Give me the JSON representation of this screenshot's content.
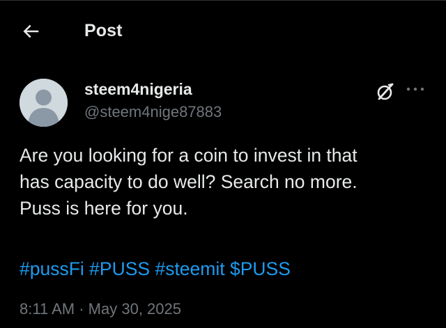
{
  "header": {
    "back_icon": "arrow-left-icon",
    "title": "Post"
  },
  "author": {
    "display_name": "steem4nigeria",
    "handle": "@steem4nige87883",
    "avatar": "default-avatar-silhouette"
  },
  "actions": {
    "grok_icon": "grok-icon",
    "more_icon": "more-horizontal-icon"
  },
  "post": {
    "lines": [
      "Are you looking for a coin to invest in that",
      "has capacity to do well? Search no more.",
      "Puss is here for you."
    ],
    "tags": [
      "#pussFi",
      "#PUSS",
      "#steemit",
      "$PUSS"
    ]
  },
  "meta": {
    "time": "8:11 AM",
    "separator": "·",
    "date": "May 30, 2025"
  },
  "colors": {
    "background": "#000000",
    "text": "#e7e9ea",
    "secondary": "#71767b",
    "link": "#1d9bf0",
    "avatar_bg": "#cfd9de"
  }
}
